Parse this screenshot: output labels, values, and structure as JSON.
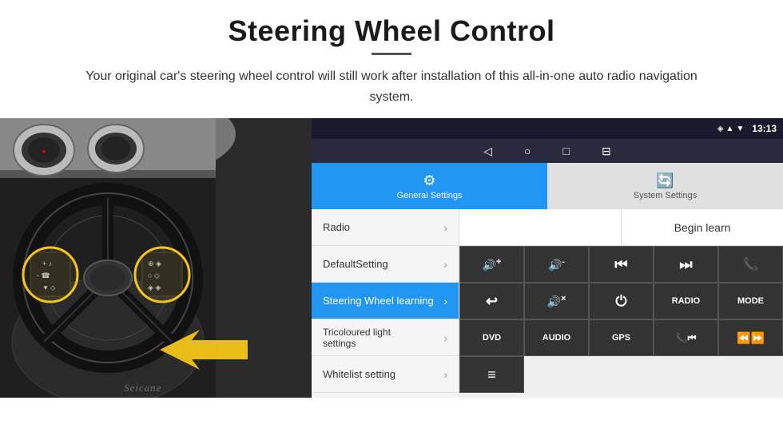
{
  "header": {
    "title": "Steering Wheel Control",
    "subtitle": "Your original car's steering wheel control will still work after installation of this all-in-one auto radio navigation system."
  },
  "status_bar": {
    "time": "13:13",
    "signal_icon": "▲",
    "wifi_icon": "▼",
    "battery_icon": "◼"
  },
  "nav_bar": {
    "back": "◁",
    "home": "○",
    "recent": "□",
    "menu": "⊟"
  },
  "tabs": {
    "general": {
      "label": "General Settings",
      "icon": "⚙"
    },
    "system": {
      "label": "System Settings",
      "icon": "🔄"
    }
  },
  "menu_items": [
    {
      "label": "Radio",
      "active": false
    },
    {
      "label": "DefaultSetting",
      "active": false
    },
    {
      "label": "Steering Wheel learning",
      "active": true
    },
    {
      "label": "Tricoloured light settings",
      "active": false
    },
    {
      "label": "Whitelist setting",
      "active": false
    }
  ],
  "begin_learn_btn": "Begin learn",
  "control_buttons_row1": [
    {
      "label": "🔊+",
      "name": "vol-up"
    },
    {
      "label": "🔊-",
      "name": "vol-down"
    },
    {
      "label": "⏮",
      "name": "prev-track"
    },
    {
      "label": "⏭",
      "name": "next-track"
    },
    {
      "label": "📞",
      "name": "call"
    }
  ],
  "control_buttons_row2": [
    {
      "label": "↩",
      "name": "return"
    },
    {
      "label": "🔇",
      "name": "mute"
    },
    {
      "label": "⏻",
      "name": "power"
    },
    {
      "label": "RADIO",
      "name": "radio"
    },
    {
      "label": "MODE",
      "name": "mode"
    }
  ],
  "control_buttons_row3": [
    {
      "label": "DVD",
      "name": "dvd"
    },
    {
      "label": "AUDIO",
      "name": "audio"
    },
    {
      "label": "GPS",
      "name": "gps"
    },
    {
      "label": "📞⏮",
      "name": "call-prev"
    },
    {
      "label": "⏪⏩",
      "name": "skip"
    }
  ],
  "control_buttons_row4": [
    {
      "label": "≡",
      "name": "list-icon"
    }
  ],
  "seicane_text": "Seicane"
}
